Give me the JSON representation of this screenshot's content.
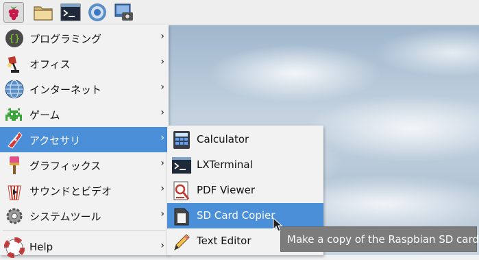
{
  "taskbar": {
    "items": [
      {
        "icon": "raspberry-icon"
      },
      {
        "icon": "folder-icon"
      },
      {
        "icon": "terminal-icon"
      },
      {
        "icon": "web-browser-icon"
      },
      {
        "icon": "screenshot-icon"
      }
    ]
  },
  "main_menu": {
    "items": [
      {
        "label": "プログラミング",
        "icon": "programming-icon"
      },
      {
        "label": "オフィス",
        "icon": "office-lamp-icon"
      },
      {
        "label": "インターネット",
        "icon": "globe-icon"
      },
      {
        "label": "ゲーム",
        "icon": "game-invader-icon"
      },
      {
        "label": "アクセサリ",
        "icon": "accessories-knife-icon"
      },
      {
        "label": "グラフィックス",
        "icon": "paintbrush-icon"
      },
      {
        "label": "サウンドとビデオ",
        "icon": "popcorn-icon"
      },
      {
        "label": "システムツール",
        "icon": "gear-icon"
      },
      {
        "label": "Help",
        "icon": "lifebuoy-icon"
      }
    ],
    "arrow": "›",
    "selected_index": 4
  },
  "sub_menu": {
    "items": [
      {
        "label": "Calculator",
        "icon": "calculator-icon"
      },
      {
        "label": "LXTerminal",
        "icon": "terminal-icon"
      },
      {
        "label": "PDF Viewer",
        "icon": "pdf-viewer-icon"
      },
      {
        "label": "SD Card Copier",
        "icon": "sd-card-icon"
      },
      {
        "label": "Text Editor",
        "icon": "pencil-icon"
      }
    ],
    "selected_index": 3
  },
  "tooltip": {
    "text": "Make a copy of the Raspbian SD card"
  },
  "colors": {
    "selection": "#4b8fd8",
    "menu_background": "#f2f2f2",
    "tooltip_background": "#7c7c7c"
  }
}
